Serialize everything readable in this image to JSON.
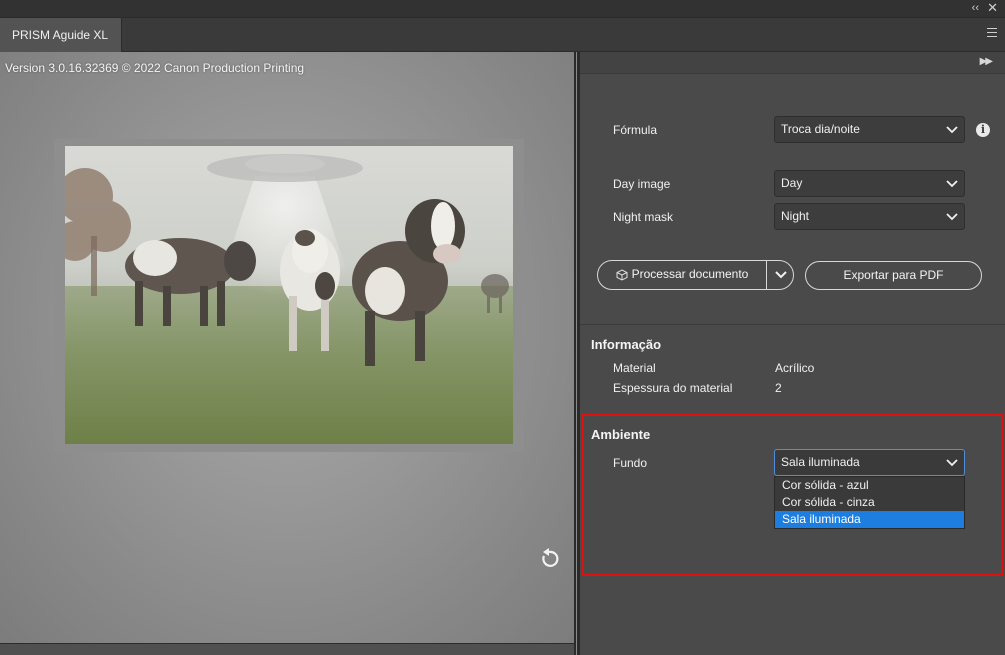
{
  "window": {
    "tab_title": "PRISM Aguide XL",
    "collapse_icon": "double-chevron-left-icon",
    "close_icon": "close-icon"
  },
  "preview": {
    "version_text": "Version 3.0.16.32369 © 2022 Canon Production Printing",
    "reset_icon": "rotate-reset-icon"
  },
  "panel": {
    "expand_icon": "double-chevron-right-icon",
    "formula": {
      "label": "Fórmula",
      "value": "Troca dia/noite"
    },
    "day_image": {
      "label": "Day image",
      "value": "Day"
    },
    "night_mask": {
      "label": "Night mask",
      "value": "Night"
    },
    "buttons": {
      "process": "Processar documento",
      "export": "Exportar para PDF"
    },
    "info": {
      "heading": "Informação",
      "material_label": "Material",
      "material_value": "Acrílico",
      "thickness_label": "Espessura do material",
      "thickness_value": "2"
    },
    "ambient": {
      "heading": "Ambiente",
      "background_label": "Fundo",
      "background_value": "Sala iluminada",
      "options": [
        "Cor sólida - azul",
        "Cor sólida - cinza",
        "Sala iluminada"
      ],
      "selected_index": 2
    }
  },
  "colors": {
    "highlight": "#e01010",
    "selection": "#1e7ee0",
    "focus_border": "#4f8ed8"
  }
}
